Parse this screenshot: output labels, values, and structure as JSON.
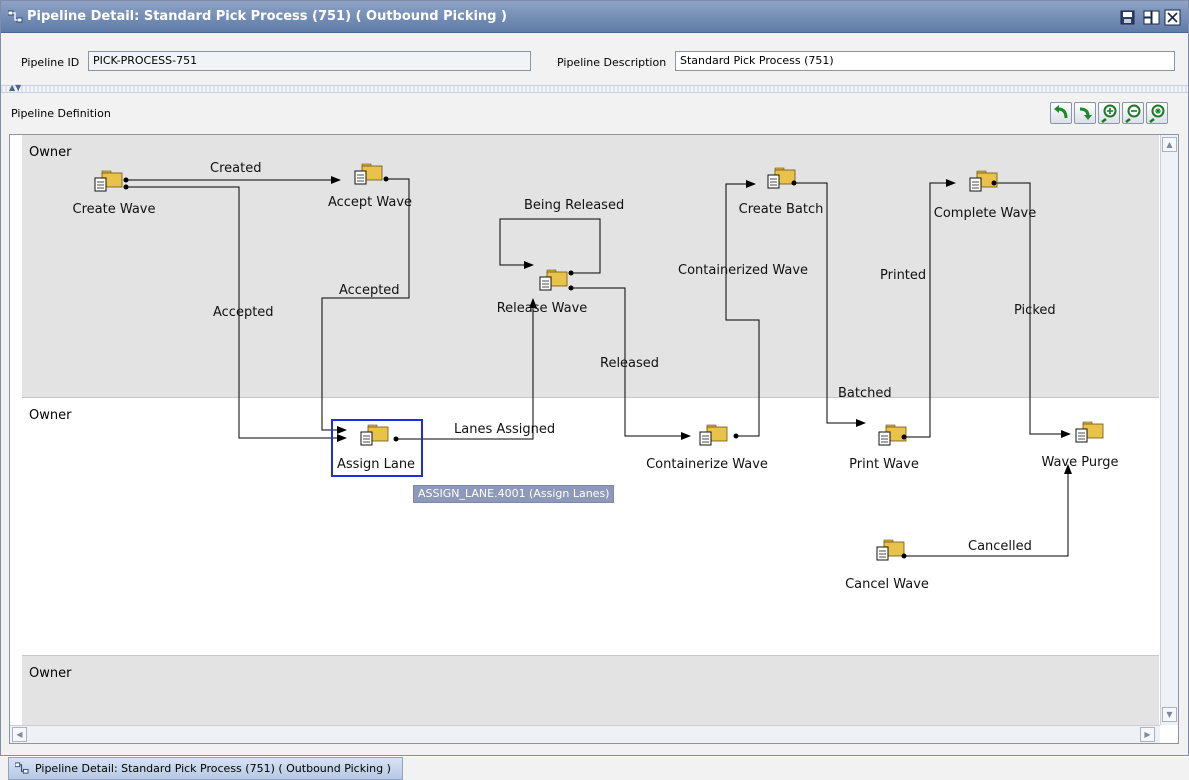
{
  "window": {
    "title": "Pipeline Detail: Standard Pick Process (751) ( Outbound Picking )",
    "icons": [
      "pipeline-icon",
      "save-icon",
      "layout-icon",
      "close-icon"
    ]
  },
  "header": {
    "pipeline_id_label": "Pipeline ID",
    "pipeline_id_value": "PICK-PROCESS-751",
    "pipeline_description_label": "Pipeline Description",
    "pipeline_description_value": "Standard Pick Process (751)"
  },
  "definition": {
    "label": "Pipeline Definition",
    "toolbar_icons": [
      "undo-icon",
      "redo-icon",
      "zoom-in-icon",
      "zoom-out-icon",
      "zoom-fit-icon"
    ]
  },
  "lanes": [
    {
      "owner": "Owner"
    },
    {
      "owner": "Owner"
    },
    {
      "owner": "Owner"
    }
  ],
  "nodes": {
    "create_wave": "Create Wave",
    "accept_wave": "Accept Wave",
    "release_wave": "Release Wave",
    "create_batch": "Create Batch",
    "complete_wave": "Complete Wave",
    "assign_lane": "Assign Lane",
    "containerize_wave": "Containerize Wave",
    "print_wave": "Print Wave",
    "wave_purge": "Wave Purge",
    "cancel_wave": "Cancel Wave"
  },
  "edges": {
    "created": "Created",
    "accepted_left": "Accepted",
    "accepted_right": "Accepted",
    "being_released": "Being Released",
    "lanes_assigned": "Lanes Assigned",
    "released": "Released",
    "containerized_wave": "Containerized Wave",
    "batched": "Batched",
    "printed": "Printed",
    "picked": "Picked",
    "cancelled": "Cancelled"
  },
  "tooltip": "ASSIGN_LANE.4001 (Assign Lanes)",
  "taskbar": {
    "tab_label": "Pipeline Detail: Standard Pick Process (751) ( Outbound Picking )"
  },
  "colors": {
    "title_bar": "#6f89b4",
    "selection": "#1f2de0",
    "node_folder": "#e0b53a"
  }
}
